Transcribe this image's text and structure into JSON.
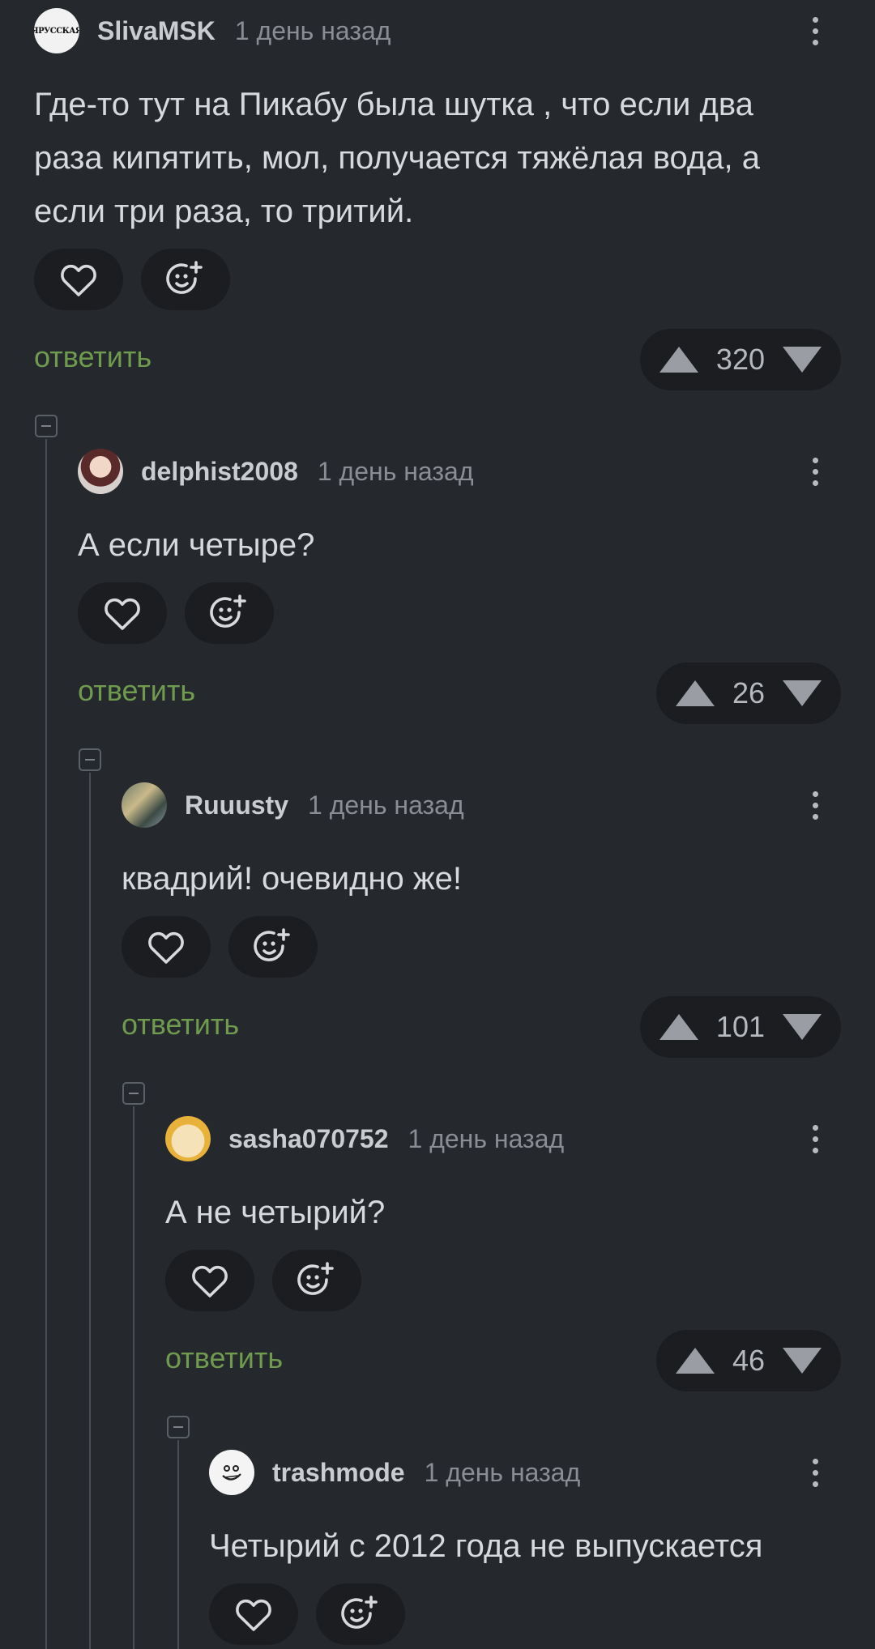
{
  "time_ago": "1 день назад",
  "reply_label": "ответить",
  "colors": {
    "background": "#25282c",
    "pill": "#1b1d20",
    "reply": "#6f9b4f",
    "text": "#d7d9dc"
  },
  "comments": [
    {
      "username": "SlivaMSK",
      "avatar_label": "ЯРУССКАЯ",
      "lines": [
        "Где-то тут на Пикабу была шутка , что если два",
        "раза кипятить, мол, получается тяжёлая вода, а",
        "если три раза, то тритий."
      ],
      "rating": "320"
    },
    {
      "username": "delphist2008",
      "lines": [
        "А если четыре?"
      ],
      "rating": "26"
    },
    {
      "username": "Ruuusty",
      "lines": [
        "квадрий! очевидно же!"
      ],
      "rating": "101"
    },
    {
      "username": "sasha070752",
      "lines": [
        "А не четырий?"
      ],
      "rating": "46"
    },
    {
      "username": "trashmode",
      "lines": [
        "Четырий с 2012 года не выпускается"
      ]
    }
  ]
}
